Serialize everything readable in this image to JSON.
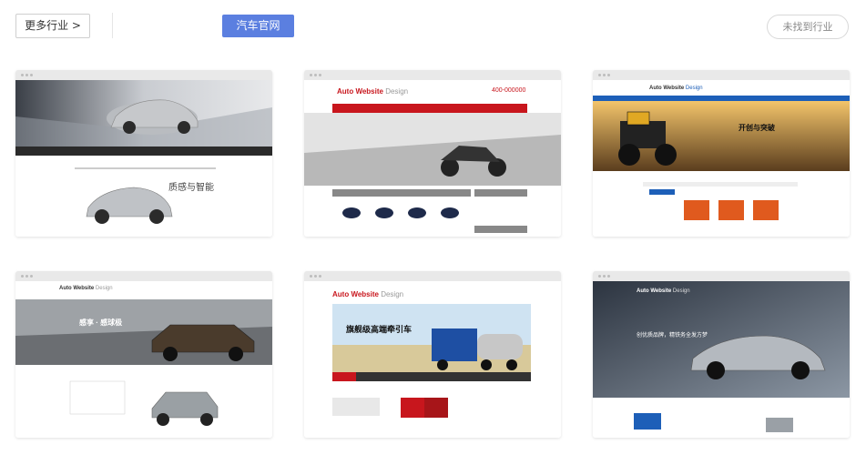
{
  "header": {
    "more_industries": "更多行业 >",
    "active_industry": "汽车官网",
    "not_found": "未找到行业"
  },
  "colors": {
    "accent": "#5b7fe0",
    "template_red": "#c8161d",
    "template_blue": "#1d5fb8"
  },
  "templates": [
    {
      "brand": "",
      "slogan": "质感与智能"
    },
    {
      "brand": "Auto Website",
      "brand_suffix": "Design",
      "phone": "400-000000",
      "slogan": ""
    },
    {
      "brand": "Auto Website",
      "brand_suffix": "Design",
      "slogan": "开创与突破"
    },
    {
      "brand": "Auto Website",
      "brand_suffix": "Design",
      "slogan": "感享 · 感球极"
    },
    {
      "brand": "Auto Website",
      "brand_suffix": "Design",
      "slogan": "旗舰级高端牵引车"
    },
    {
      "brand": "Auto Website",
      "brand_suffix": "Design",
      "slogan": "创优质品牌，精铁务全发方梦"
    }
  ]
}
